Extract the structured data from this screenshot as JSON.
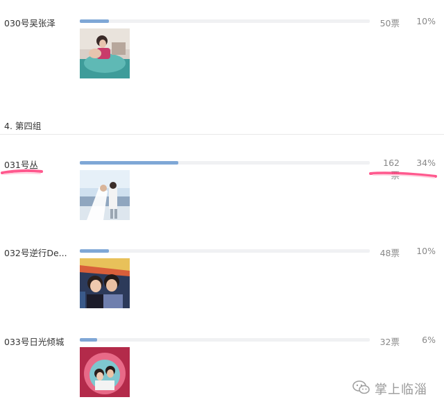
{
  "poll": {
    "candidates": [
      {
        "name": "030号吴张泽",
        "votes": "50票",
        "percent": "10%",
        "fraction": 0.1
      },
      {
        "name": "031号丛",
        "votes": "162票",
        "percent": "34%",
        "fraction": 0.34
      },
      {
        "name": "032号逆行De...",
        "votes": "48票",
        "percent": "10%",
        "fraction": 0.1
      },
      {
        "name": "033号日光倾城",
        "votes": "32票",
        "percent": "6%",
        "fraction": 0.06
      }
    ],
    "group_title": "4. 第四组"
  },
  "watermark": {
    "text": "掌上临淄",
    "icon": "wechat-icon"
  },
  "colors": {
    "bar_fill": "#7fa7d6",
    "bar_track": "#f0f1f3",
    "highlight_marker": "#ff3c7a"
  }
}
